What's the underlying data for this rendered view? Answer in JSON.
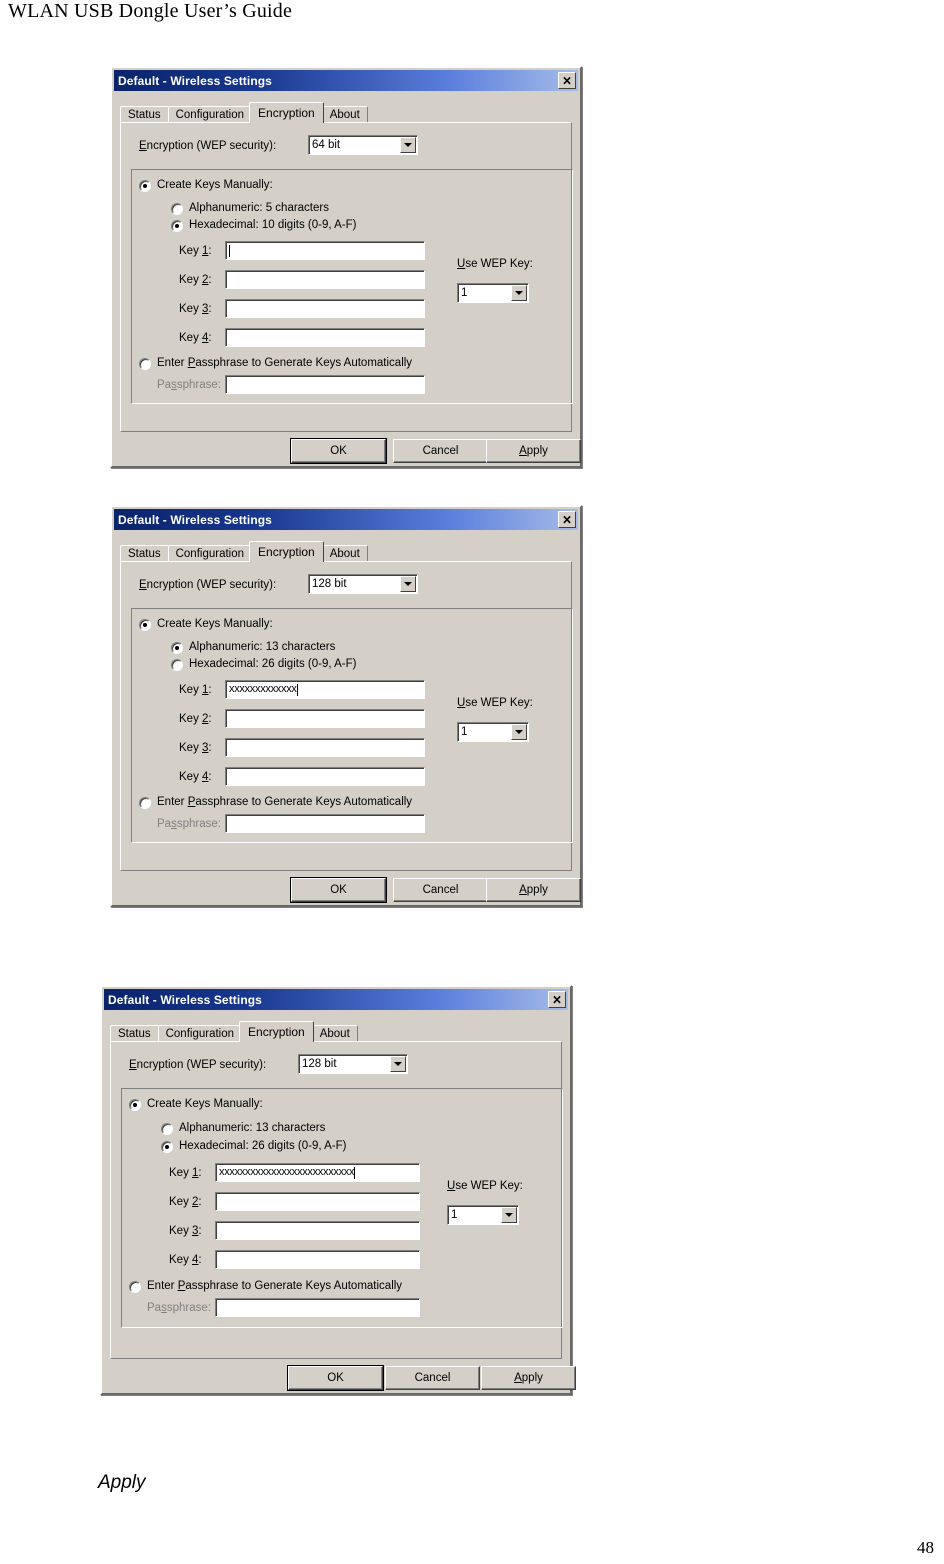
{
  "document": {
    "header": "WLAN USB Dongle User’s Guide",
    "page_number": "48",
    "caption": "Apply"
  },
  "common": {
    "window_title": "Default - Wireless Settings",
    "close_icon": "close-icon",
    "tabs": [
      {
        "label": "Status",
        "active": false
      },
      {
        "label": "Configuration",
        "active": false
      },
      {
        "label": "Encryption",
        "active": true
      },
      {
        "label": "About",
        "active": false
      }
    ],
    "encryption_label": "Encryption (WEP security):",
    "create_keys_label": "Create Keys Manually:",
    "key_labels": [
      "Key 1:",
      "Key 2:",
      "Key 3:",
      "Key 4:"
    ],
    "use_wep_key_label": "Use WEP Key:",
    "use_wep_key_value": "1",
    "passphrase_radio_label": "Enter Passphrase to Generate Keys Automatically",
    "passphrase_field_label": "Passphrase:",
    "passphrase_value": "",
    "buttons": {
      "ok": "OK",
      "cancel": "Cancel",
      "apply": "Apply"
    },
    "colors": {
      "dialog_face": "#d4d0c8",
      "titlebar_start": "#0a246a",
      "titlebar_end": "#a6bce8",
      "title_text": "#ffffff",
      "disabled_text": "#808080",
      "field_bg": "#ffffff"
    }
  },
  "dialogs": [
    {
      "id": "wep-64bit",
      "encryption_value": "64 bit",
      "create_keys_selected": true,
      "alphanumeric_label": "Alphanumeric: 5 characters",
      "alphanumeric_selected": false,
      "hexadecimal_label": "Hexadecimal: 10 digits (0-9, A-F)",
      "hexadecimal_selected": true,
      "passphrase_selected": false,
      "key_values": [
        "",
        "",
        "",
        ""
      ],
      "key1_has_caret": true,
      "use_wep_key_value": "1"
    },
    {
      "id": "wep-128bit-alphanumeric",
      "encryption_value": "128 bit",
      "create_keys_selected": true,
      "alphanumeric_label": "Alphanumeric: 13 characters",
      "alphanumeric_selected": true,
      "hexadecimal_label": "Hexadecimal: 26 digits (0-9, A-F)",
      "hexadecimal_selected": false,
      "passphrase_selected": false,
      "key_values": [
        "xxxxxxxxxxxxx",
        "",
        "",
        ""
      ],
      "key1_has_caret": true,
      "use_wep_key_value": "1"
    },
    {
      "id": "wep-128bit-hexadecimal",
      "encryption_value": "128 bit",
      "create_keys_selected": true,
      "alphanumeric_label": "Alphanumeric: 13 characters",
      "alphanumeric_selected": false,
      "hexadecimal_label": "Hexadecimal: 26 digits (0-9, A-F)",
      "hexadecimal_selected": true,
      "passphrase_selected": false,
      "key_values": [
        "xxxxxxxxxxxxxxxxxxxxxxxxxx",
        "",
        "",
        ""
      ],
      "key1_has_caret": true,
      "use_wep_key_value": "1"
    }
  ]
}
